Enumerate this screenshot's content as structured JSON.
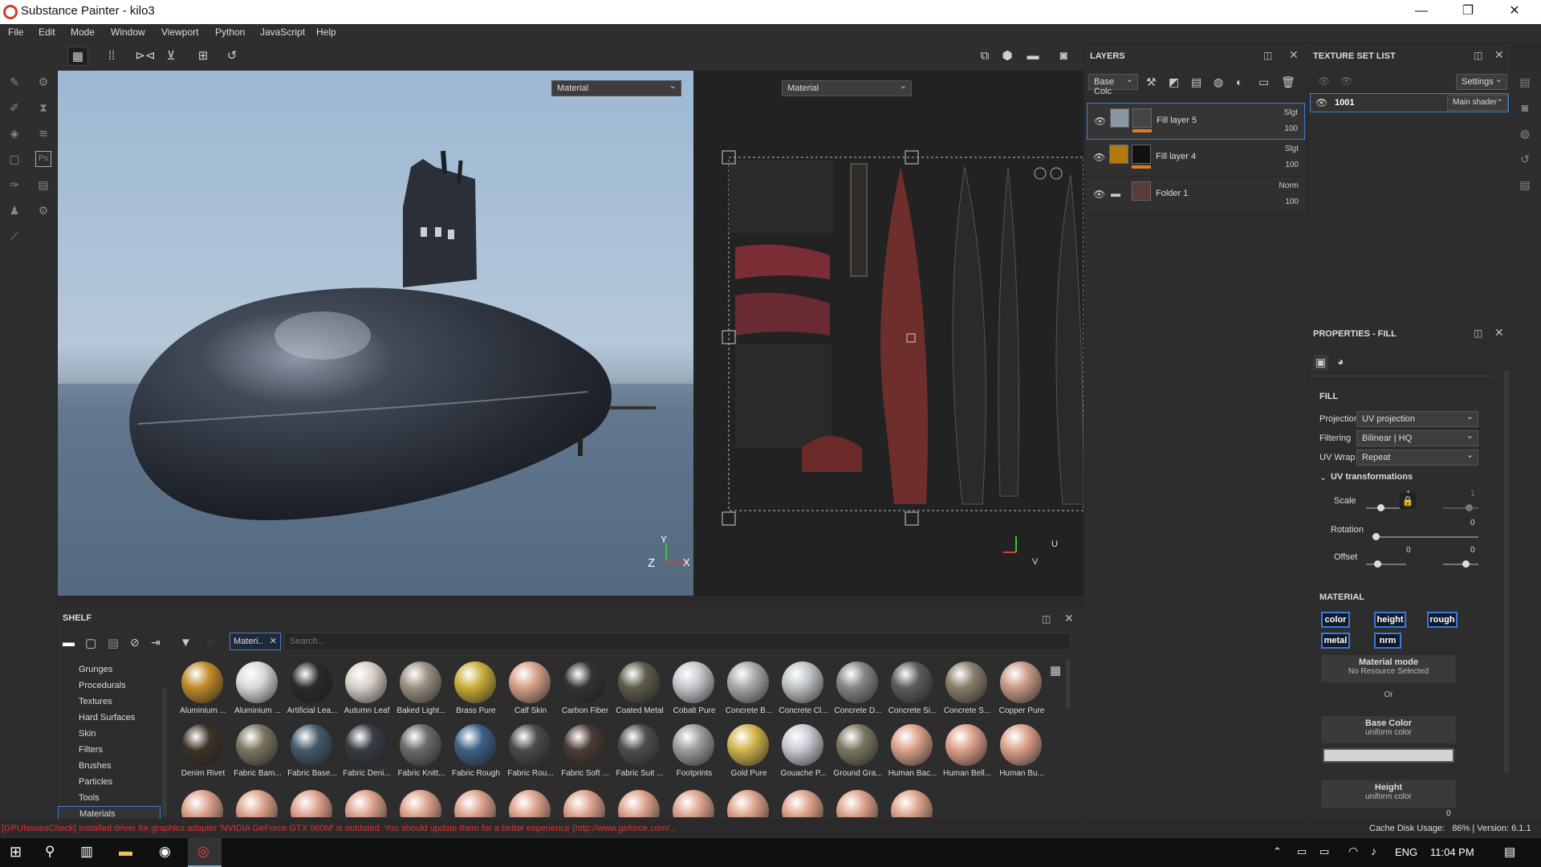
{
  "window": {
    "title": "Substance Painter - kilo3"
  },
  "menu": [
    "File",
    "Edit",
    "Mode",
    "Window",
    "Viewport",
    "Python",
    "JavaScript",
    "Help"
  ],
  "viewport": {
    "mode_left": "Material",
    "mode_right": "Material",
    "axis_z": "Z",
    "axis_y": "Y",
    "axis_x": "X",
    "axis_u": "U",
    "axis_v": "V"
  },
  "layers": {
    "title": "LAYERS",
    "channel": "Base Colc",
    "items": [
      {
        "name": "Fill layer 5",
        "blend": "Slgt",
        "opacity": "100"
      },
      {
        "name": "Fill layer 4",
        "blend": "Slgt",
        "opacity": "100"
      },
      {
        "name": "Folder 1",
        "blend": "Norm",
        "opacity": "100"
      }
    ]
  },
  "texture_set": {
    "title": "TEXTURE SET LIST",
    "settings": "Settings",
    "name": "1001",
    "shader": "Main shader"
  },
  "properties": {
    "title": "PROPERTIES - FILL",
    "fill_heading": "FILL",
    "projection_label": "Projection",
    "projection": "UV projection",
    "filtering_label": "Filtering",
    "filtering": "Bilinear | HQ",
    "uvwrap_label": "UV Wrap",
    "uvwrap": "Repeat",
    "uvt": "UV transformations",
    "scale_label": "Scale",
    "scale_val": "1",
    "scale_val2": "1",
    "rotation_label": "Rotation",
    "rotation_val": "0",
    "offset_label": "Offset",
    "offset_x": "0",
    "offset_y": "0",
    "material_heading": "MATERIAL",
    "chips": [
      "color",
      "height",
      "rough",
      "metal",
      "nrm"
    ],
    "mode_title": "Material mode",
    "mode_sub": "No Resource Selected",
    "or": "Or",
    "basecolor_title": "Base Color",
    "basecolor_sub": "uniform color",
    "height_title": "Height",
    "height_sub": "uniform color",
    "height_val": "0"
  },
  "shelf": {
    "title": "SHELF",
    "filter_tag": "Materi..",
    "search_placeholder": "Search...",
    "categories": [
      "Grunges",
      "Procedurals",
      "Textures",
      "Hard Surfaces",
      "Skin",
      "Filters",
      "Brushes",
      "Particles",
      "Tools",
      "Materials"
    ],
    "row1": [
      {
        "label": "Aluminium ...",
        "c": "#c08a28"
      },
      {
        "label": "Aluminium ...",
        "c": "#d8d8d8"
      },
      {
        "label": "Artificial Lea...",
        "c": "#2a2a2a"
      },
      {
        "label": "Autumn Leaf",
        "c": "#d8cfc8"
      },
      {
        "label": "Baked Light...",
        "c": "#9a8f80"
      },
      {
        "label": "Brass Pure",
        "c": "#c9ad3a"
      },
      {
        "label": "Calf Skin",
        "c": "#d6a088"
      },
      {
        "label": "Carbon Fiber",
        "c": "#333"
      },
      {
        "label": "Coated Metal",
        "c": "#5d5b4a"
      },
      {
        "label": "Cobalt Pure",
        "c": "#c4c6cc"
      },
      {
        "label": "Concrete B...",
        "c": "#a8a8a8"
      },
      {
        "label": "Concrete Cl...",
        "c": "#bfc3c6"
      },
      {
        "label": "Concrete D...",
        "c": "#858585"
      },
      {
        "label": "Concrete Si...",
        "c": "#5a5c5e"
      },
      {
        "label": "Concrete S...",
        "c": "#8a7e6a"
      },
      {
        "label": "Copper Pure",
        "c": "#c89a86"
      }
    ],
    "row2": [
      {
        "label": "Denim Rivet",
        "c": "#3d3326"
      },
      {
        "label": "Fabric Bam...",
        "c": "#7a7460"
      },
      {
        "label": "Fabric Base...",
        "c": "#44596a"
      },
      {
        "label": "Fabric Deni...",
        "c": "#383d44"
      },
      {
        "label": "Fabric Knitt...",
        "c": "#6a6a6a"
      },
      {
        "label": "Fabric Rough",
        "c": "#3f5f86"
      },
      {
        "label": "Fabric Rou...",
        "c": "#4a4a4a"
      },
      {
        "label": "Fabric Soft ...",
        "c": "#4a3b34"
      },
      {
        "label": "Fabric Suit ...",
        "c": "#4d4d4d"
      },
      {
        "label": "Footprints",
        "c": "#9c9c9c"
      },
      {
        "label": "Gold Pure",
        "c": "#d1b44a"
      },
      {
        "label": "Gouache P...",
        "c": "#c8c8d2"
      },
      {
        "label": "Ground Gra...",
        "c": "#7a7660"
      },
      {
        "label": "Human Bac...",
        "c": "#dca08a"
      },
      {
        "label": "Human Bell...",
        "c": "#dca08a"
      },
      {
        "label": "Human Bu...",
        "c": "#dca08a"
      }
    ]
  },
  "status": {
    "message": "[GPUIssuesCheck] Installed driver for graphics adapter 'NVIDIA GeForce GTX 960M' is outdated. You should update them for a better experience (http://www.geforce.com/...",
    "cache": "Cache Disk Usage:   86% | Version: 6.1.1"
  },
  "taskbar": {
    "lang": "ENG",
    "time": "11:04 PM"
  }
}
